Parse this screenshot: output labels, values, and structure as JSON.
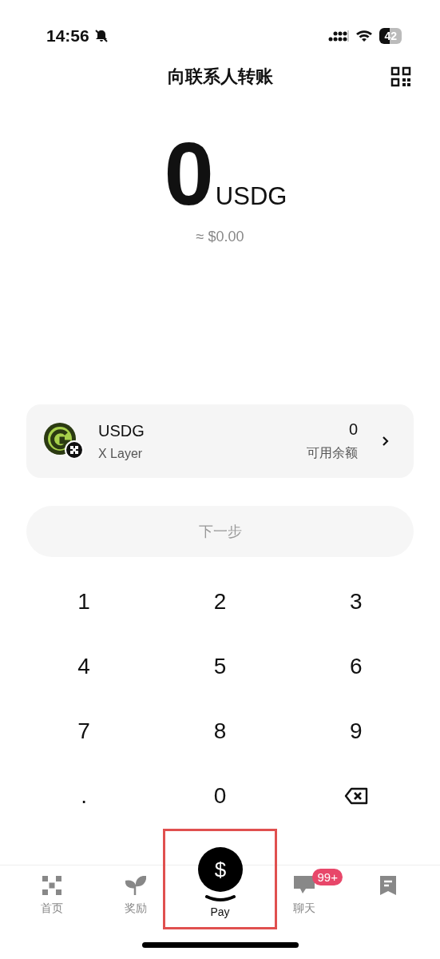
{
  "status_bar": {
    "time": "14:56",
    "battery": "42"
  },
  "header": {
    "title": "向联系人转账"
  },
  "amount": {
    "value": "0",
    "unit": "USDG",
    "fiat": "≈ $0.00"
  },
  "token": {
    "symbol": "USDG",
    "network": "X Layer",
    "balance": "0",
    "balance_label": "可用余额"
  },
  "next_button": {
    "label": "下一步",
    "disabled": true
  },
  "keypad": [
    {
      "kind": "digit",
      "label": "1"
    },
    {
      "kind": "digit",
      "label": "2"
    },
    {
      "kind": "digit",
      "label": "3"
    },
    {
      "kind": "digit",
      "label": "4"
    },
    {
      "kind": "digit",
      "label": "5"
    },
    {
      "kind": "digit",
      "label": "6"
    },
    {
      "kind": "digit",
      "label": "7"
    },
    {
      "kind": "digit",
      "label": "8"
    },
    {
      "kind": "digit",
      "label": "9"
    },
    {
      "kind": "digit",
      "label": "."
    },
    {
      "kind": "digit",
      "label": "0"
    },
    {
      "kind": "backspace"
    }
  ],
  "tab_bar": [
    {
      "kind": "home",
      "label": "首页",
      "selected": false,
      "highlighted": false
    },
    {
      "kind": "rewards",
      "label": "奖励",
      "selected": false,
      "highlighted": false
    },
    {
      "kind": "pay",
      "symbol": "$",
      "label": "Pay",
      "selected": true,
      "highlighted": true
    },
    {
      "kind": "chat",
      "label": "聊天",
      "selected": false,
      "highlighted": false,
      "badge": "99+"
    },
    {
      "kind": "orders",
      "selected": false,
      "highlighted": false
    }
  ]
}
